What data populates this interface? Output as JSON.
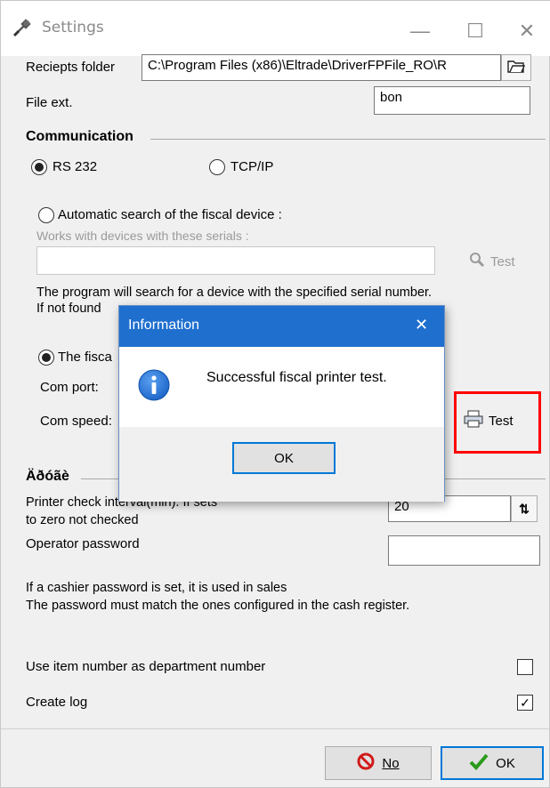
{
  "window": {
    "title": "Settings",
    "controls": {
      "minimize": "—",
      "maximize": "☐",
      "close": "✕"
    }
  },
  "receipts": {
    "folder_label": "Reciepts folder",
    "folder_value": "C:\\Program Files (x86)\\Eltrade\\DriverFPFile_RO\\R",
    "ext_label": "File ext.",
    "ext_value": "bon"
  },
  "communication": {
    "title": "Communication",
    "rs232_label": "RS 232",
    "rs232_selected": true,
    "tcpip_label": "TCP/IP",
    "tcpip_selected": false,
    "auto_search_label": "Automatic search of the fiscal device :",
    "serials_hint": "Works with devices with these serials :",
    "serials_value": "",
    "test_label": "Test",
    "search_note_1": "The program will search for a device with the specified serial number.",
    "search_note_2": "If not found",
    "fixed_label": "The fisca",
    "com_port_label": "Com port:",
    "com_speed_label": "Com speed:",
    "printer_test_label": "Test"
  },
  "other": {
    "title": "Äðóãè",
    "check_interval_label_1": "Printer check interval(min). If sets",
    "check_interval_label_2": "to zero not checked",
    "check_interval_value": "20",
    "operator_password_label": "Operator password",
    "operator_password_value": "",
    "cashier_note_1": "If a cashier password is set, it is used in sales",
    "cashier_note_2": "The password must match the ones configured in the cash register.",
    "item_number_label": "Use item number as department number",
    "item_number_checked": false,
    "create_log_label": "Create log",
    "create_log_checked": true
  },
  "footer": {
    "no_label": "No",
    "ok_label": "OK"
  },
  "dialog": {
    "title": "Information",
    "close_glyph": "✕",
    "message": "Successful fiscal printer test.",
    "ok_label": "OK"
  },
  "colors": {
    "dialog_titlebar": "#1f6fcf",
    "highlight": "#ff0000",
    "ok_check": "#2a9a1a",
    "no_icon": "#d11a1a",
    "info_icon": "#1a64c8"
  }
}
